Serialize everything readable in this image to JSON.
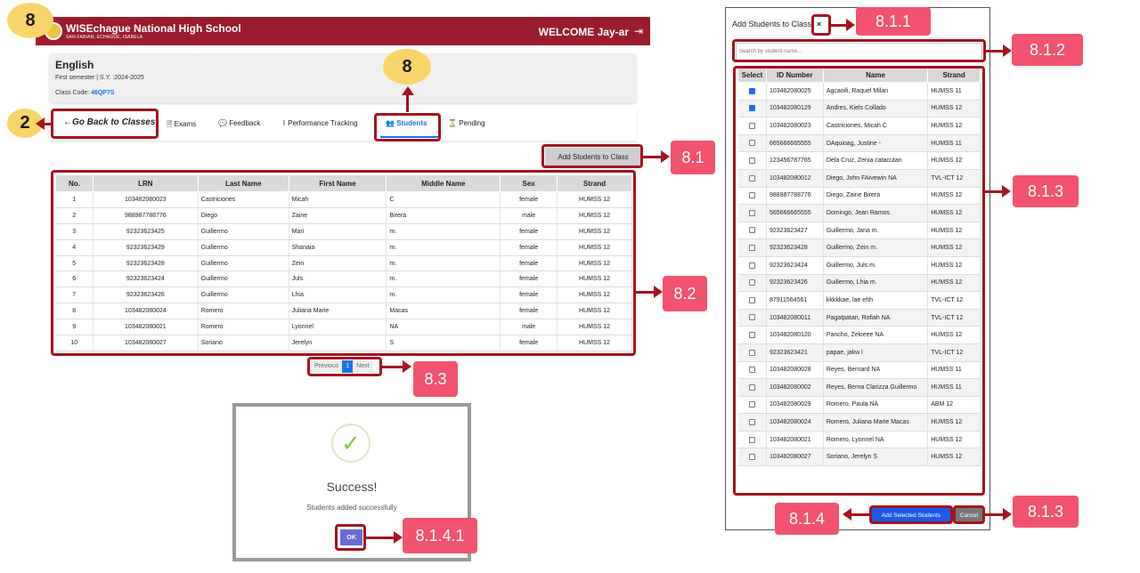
{
  "header": {
    "school_name": "WISEchague National High School",
    "school_address": "SAN FABIAN, ECHAGUE, ISABELA",
    "welcome": "WELCOME Jay-ar"
  },
  "class_info": {
    "title": "English",
    "semester": "First semester | S.Y. :2024-2025",
    "code_label": "Class Code: ",
    "code": "46QP7S"
  },
  "nav": {
    "back": "Go Back to Classes",
    "exams": "Exams",
    "feedback": "Feedback",
    "performance": "Performance Tracking",
    "students": "Students",
    "pending": "Pending"
  },
  "add_class_button": "Add Students to Class",
  "roster": {
    "columns": [
      "No.",
      "LRN",
      "Last Name",
      "First Name",
      "Middle Name",
      "Sex",
      "Strand"
    ],
    "rows": [
      [
        "1",
        "103482080023",
        "Castriciones",
        "Micah",
        "C",
        "female",
        "HUMSS 12"
      ],
      [
        "2",
        "988987788776",
        "Diego",
        "Zaine",
        "Birera",
        "male",
        "HUMSS 12"
      ],
      [
        "3",
        "92323623425",
        "Guillermo",
        "Mari",
        "m.",
        "female",
        "HUMSS 12"
      ],
      [
        "4",
        "92323623429",
        "Guillermo",
        "Shanaia",
        "m.",
        "female",
        "HUMSS 12"
      ],
      [
        "5",
        "92323623428",
        "Guillermo",
        "Zein",
        "m.",
        "female",
        "HUMSS 12"
      ],
      [
        "6",
        "92323623424",
        "Guillermo",
        "Juls",
        "m.",
        "female",
        "HUMSS 12"
      ],
      [
        "7",
        "92323623426",
        "Guillermo",
        "Lhia",
        "m.",
        "female",
        "HUMSS 12"
      ],
      [
        "8",
        "103482080024",
        "Romero",
        "Juliana Marie",
        "Macas",
        "female",
        "HUMSS 12"
      ],
      [
        "9",
        "103482080021",
        "Romero",
        "Lyonnel",
        "NA",
        "male",
        "HUMSS 12"
      ],
      [
        "10",
        "103482080027",
        "Soriano",
        "Jerelyn",
        "S",
        "female",
        "HUMSS 12"
      ]
    ]
  },
  "pagination": {
    "previous": "Previous",
    "page": "1",
    "next": "Next"
  },
  "success_modal": {
    "title": "Success!",
    "message": "Students added successfully",
    "ok": "OK"
  },
  "add_panel": {
    "title": "Add Students to Class",
    "close": "×",
    "search_placeholder": "Search by student name...",
    "columns": [
      "Select",
      "ID Number",
      "Name",
      "Strand"
    ],
    "rows": [
      {
        "checked": true,
        "id": "103482080025",
        "name": "Agcaoili, Raquel Milan",
        "strand": "HUMSS 11"
      },
      {
        "checked": true,
        "id": "103482080129",
        "name": "Andres, Kiels Collado",
        "strand": "HUMSS 12"
      },
      {
        "checked": false,
        "id": "103482080023",
        "name": "Castriciones, Micah C",
        "strand": "HUMSS 12"
      },
      {
        "checked": false,
        "id": "665666665555",
        "name": "DAquioag, Justine -",
        "strand": "HUMSS 11"
      },
      {
        "checked": false,
        "id": "123456787765",
        "name": "Dela Cruz, Zenia catacutan",
        "strand": "HUMSS 12"
      },
      {
        "checked": false,
        "id": "103482080012",
        "name": "Diego, John FAivewin NA",
        "strand": "TVL-ICT 12"
      },
      {
        "checked": false,
        "id": "988987788776",
        "name": "Diego, Zaine Birera",
        "strand": "HUMSS 12"
      },
      {
        "checked": false,
        "id": "565666665555",
        "name": "Domingo, Jean Ramos",
        "strand": "HUMSS 12"
      },
      {
        "checked": false,
        "id": "92323623427",
        "name": "Guillermo, Jana m.",
        "strand": "HUMSS 12"
      },
      {
        "checked": false,
        "id": "92323623428",
        "name": "Guillermo, Zein m.",
        "strand": "HUMSS 12"
      },
      {
        "checked": false,
        "id": "92323623424",
        "name": "Guillermo, Juls m.",
        "strand": "HUMSS 12"
      },
      {
        "checked": false,
        "id": "92323623426",
        "name": "Guillermo, Lhia m.",
        "strand": "HUMSS 12"
      },
      {
        "checked": false,
        "id": "87911564561",
        "name": "kkkkkae, lae ehh",
        "strand": "TVL-ICT 12"
      },
      {
        "checked": false,
        "id": "103482080011",
        "name": "Pagatpatan, Rofiah NA",
        "strand": "TVL-ICT 12"
      },
      {
        "checked": false,
        "id": "103482080120",
        "name": "Pancho, Zekieee NA",
        "strand": "HUMSS 12"
      },
      {
        "checked": false,
        "id": "92323623421",
        "name": "papae, jakw l",
        "strand": "TVL-ICT 12"
      },
      {
        "checked": false,
        "id": "103482080028",
        "name": "Reyes, Bernard NA",
        "strand": "HUMSS 11"
      },
      {
        "checked": false,
        "id": "103482080002",
        "name": "Reyes, Berna Clarizza Guillermo",
        "strand": "HUMSS 11"
      },
      {
        "checked": false,
        "id": "103482080029",
        "name": "Romero, Paula NA",
        "strand": "ABM 12"
      },
      {
        "checked": false,
        "id": "103482080024",
        "name": "Romero, Juliana Marie Macas",
        "strand": "HUMSS 12"
      },
      {
        "checked": false,
        "id": "103482080021",
        "name": "Romero, Lyonnel NA",
        "strand": "HUMSS 12"
      },
      {
        "checked": false,
        "id": "103482080027",
        "name": "Soriano, Jerelyn S",
        "strand": "HUMSS 12"
      }
    ],
    "add_selected": "Add Selected Students",
    "cancel": "Cancel"
  },
  "callouts": {
    "c8_top": "8",
    "c8_nav": "8",
    "c2": "2",
    "c81": "8.1",
    "c82": "8.2",
    "c83": "8.3",
    "c8141": "8.1.4.1",
    "c811": "8.1.1",
    "c812": "8.1.2",
    "c813_table": "8.1.3",
    "c814": "8.1.4",
    "c813_cancel": "8.1.3"
  },
  "colors": {
    "header": "#9b1c2c",
    "accent": "#1a73e8",
    "callout_border": "#a3141f",
    "callout_yellow": "#f8d568",
    "callout_pink": "#f2536f"
  }
}
